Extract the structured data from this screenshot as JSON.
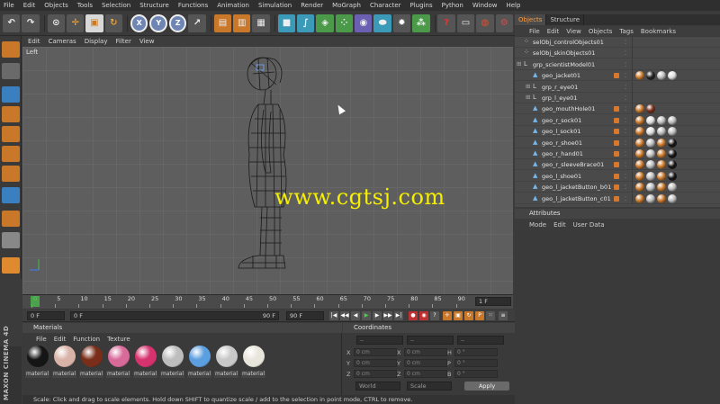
{
  "menubar": {
    "items": [
      "File",
      "Edit",
      "Objects",
      "Tools",
      "Selection",
      "Structure",
      "Functions",
      "Animation",
      "Simulation",
      "Render",
      "MoGraph",
      "Character",
      "Plugins",
      "Python",
      "Window",
      "Help"
    ]
  },
  "toolbar": {
    "axis_x": "X",
    "axis_y": "Y",
    "axis_z": "Z"
  },
  "viewport": {
    "menu": [
      "Edit",
      "Cameras",
      "Display",
      "Filter",
      "View"
    ],
    "label": "Left"
  },
  "watermark": "www.cgtsj.com",
  "timeline": {
    "ticks": [
      "0",
      "5",
      "10",
      "15",
      "20",
      "25",
      "30",
      "35",
      "40",
      "45",
      "50",
      "55",
      "60",
      "65",
      "70",
      "75",
      "80",
      "85",
      "90"
    ],
    "current_frame": "1 F"
  },
  "transport": {
    "start": "0 F",
    "preview_start": "0 F",
    "preview_end": "90 F",
    "end": "90 F"
  },
  "materials": {
    "title": "Materials",
    "menu": [
      "File",
      "Edit",
      "Function",
      "Texture"
    ],
    "items": [
      {
        "label": "material",
        "color": "#151515"
      },
      {
        "label": "material",
        "color": "#d9b3a8"
      },
      {
        "label": "material",
        "color": "#7a2e1a"
      },
      {
        "label": "material",
        "color": "#d86a9a"
      },
      {
        "label": "material",
        "color": "#d6326e"
      },
      {
        "label": "material",
        "color": "#bdbdbd"
      },
      {
        "label": "material",
        "color": "#5c9fe0"
      },
      {
        "label": "material",
        "color": "#c8c8c8"
      },
      {
        "label": "material",
        "color": "#e8e6dc"
      }
    ]
  },
  "coordinates": {
    "title": "Coordinates",
    "rows": [
      {
        "a": "X",
        "av": "0 cm",
        "b": "X",
        "bv": "0 cm",
        "c": "H",
        "cv": "0 °"
      },
      {
        "a": "Y",
        "av": "0 cm",
        "b": "Y",
        "bv": "0 cm",
        "c": "P",
        "cv": "0 °"
      },
      {
        "a": "Z",
        "av": "0 cm",
        "b": "Z",
        "bv": "0 cm",
        "c": "B",
        "cv": "0 °"
      }
    ],
    "mode_world": "World",
    "mode_scale": "Scale",
    "apply": "Apply"
  },
  "status": "Scale: Click and drag to scale elements. Hold down SHIFT to quantize scale / add to the selection in point mode, CTRL to remove.",
  "brand": "MAXON CINEMA 4D",
  "objects": {
    "tabs": [
      "Objects",
      "Structure"
    ],
    "menu": [
      "File",
      "Edit",
      "View",
      "Objects",
      "Tags",
      "Bookmarks"
    ],
    "rows": [
      {
        "name": "selObj_controlObjects01",
        "indent": 0,
        "icon": "sel",
        "tags": []
      },
      {
        "name": "selObj_skinObjects01",
        "indent": 0,
        "icon": "sel",
        "tags": []
      },
      {
        "name": "grp_scientistModel01",
        "indent": 0,
        "icon": "null",
        "tags": []
      },
      {
        "name": "geo_jacket01",
        "indent": 1,
        "icon": "poly",
        "tags": [
          "#c9782a",
          "#222",
          "#bbb",
          "#ddd"
        ]
      },
      {
        "name": "grp_r_eye01",
        "indent": 1,
        "icon": "null",
        "tags": []
      },
      {
        "name": "grp_l_eye01",
        "indent": 1,
        "icon": "null",
        "tags": []
      },
      {
        "name": "geo_mouthHole01",
        "indent": 1,
        "icon": "poly",
        "tags": [
          "#c9782a",
          "#7a2e1a"
        ]
      },
      {
        "name": "geo_r_sock01",
        "indent": 1,
        "icon": "poly",
        "tags": [
          "#c9782a",
          "#ddd",
          "#bbb",
          "#bbb"
        ]
      },
      {
        "name": "geo_l_sock01",
        "indent": 1,
        "icon": "poly",
        "tags": [
          "#c9782a",
          "#ddd",
          "#bbb",
          "#bbb"
        ]
      },
      {
        "name": "geo_r_shoe01",
        "indent": 1,
        "icon": "poly",
        "tags": [
          "#c9782a",
          "#bbb",
          "#c9782a",
          "#151515"
        ]
      },
      {
        "name": "geo_r_hand01",
        "indent": 1,
        "icon": "poly",
        "tags": [
          "#c9782a",
          "#bbb",
          "#c9782a",
          "#151515"
        ]
      },
      {
        "name": "geo_r_sleeveBrace01",
        "indent": 1,
        "icon": "poly",
        "tags": [
          "#c9782a",
          "#bbb",
          "#c9782a",
          "#151515"
        ]
      },
      {
        "name": "geo_l_shoe01",
        "indent": 1,
        "icon": "poly",
        "tags": [
          "#c9782a",
          "#bbb",
          "#c9782a",
          "#151515"
        ]
      },
      {
        "name": "geo_l_jacketButton_b01",
        "indent": 1,
        "icon": "poly",
        "tags": [
          "#c9782a",
          "#bbb",
          "#c9782a",
          "#bbb"
        ]
      },
      {
        "name": "geo_l_jacketButton_c01",
        "indent": 1,
        "icon": "poly",
        "tags": [
          "#c9782a",
          "#bbb",
          "#c9782a",
          "#bbb"
        ]
      }
    ]
  },
  "attributes": {
    "title": "Attributes",
    "menu": [
      "Mode",
      "Edit",
      "User Data"
    ]
  }
}
